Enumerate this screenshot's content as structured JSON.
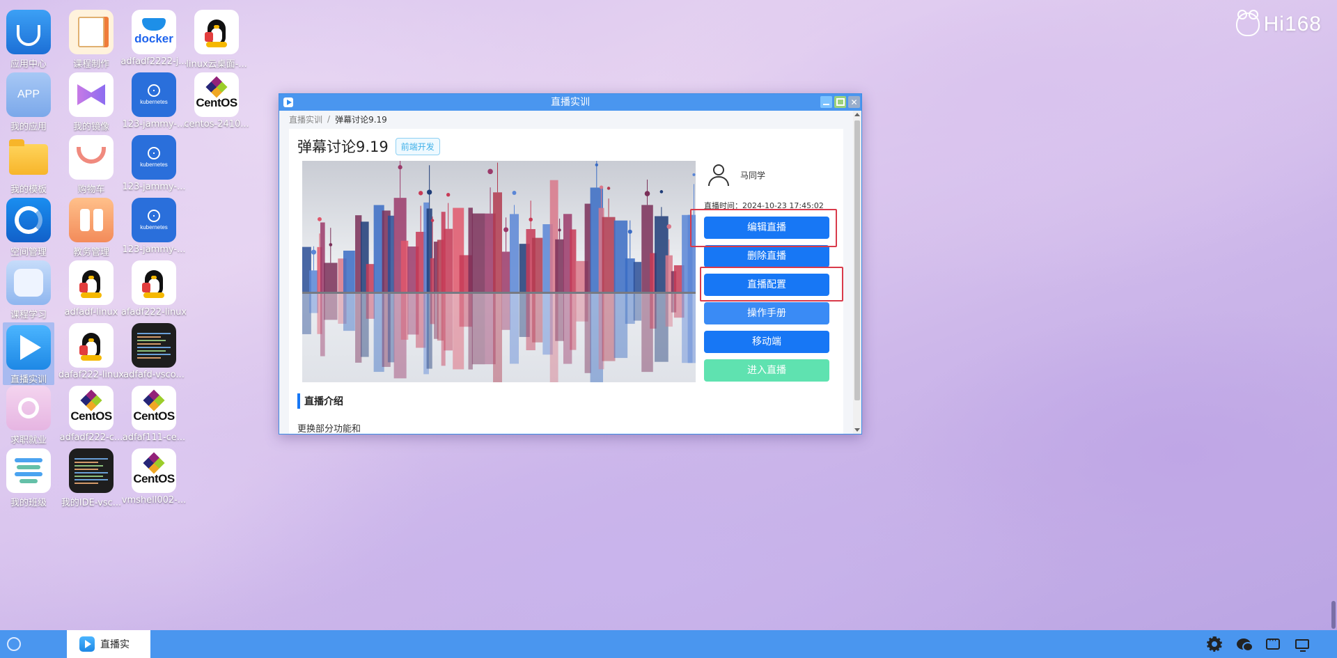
{
  "brand": {
    "logo_text": "Hi168"
  },
  "desktop": {
    "icons": [
      {
        "label": "应用中心",
        "icon": "app-center-icon"
      },
      {
        "label": "课程制作",
        "icon": "course-make-icon"
      },
      {
        "label": "adfadf2222-j...",
        "icon": "docker-icon",
        "logo_text": "docker"
      },
      {
        "label": "linux云桌面-...",
        "icon": "linux-tux-icon"
      },
      {
        "label": "我的应用",
        "icon": "my-app-icon",
        "logo_text": "APP"
      },
      {
        "label": "我的镜像",
        "icon": "my-image-icon"
      },
      {
        "label": "123-jammy-...",
        "icon": "kubernetes-icon",
        "logo_text": "kubernetes"
      },
      {
        "label": "centos-2410...",
        "icon": "centos-icon",
        "logo_text": "CentOS"
      },
      {
        "label": "我的模板",
        "icon": "folder-icon"
      },
      {
        "label": "购物车",
        "icon": "cart-icon"
      },
      {
        "label": "123-jammy-...",
        "icon": "kubernetes-icon",
        "logo_text": "kubernetes"
      },
      {
        "label": "空间管理",
        "icon": "space-manage-icon"
      },
      {
        "label": "教务管理",
        "icon": "edu-manage-icon"
      },
      {
        "label": "123-jammy-...",
        "icon": "kubernetes-icon",
        "logo_text": "kubernetes"
      },
      {
        "label": "课程学习",
        "icon": "course-study-icon"
      },
      {
        "label": "adfadf-linux",
        "icon": "linux-tux-icon"
      },
      {
        "label": "afadf222-linux",
        "icon": "linux-tux-icon"
      },
      {
        "label": "直播实训",
        "icon": "live-training-icon"
      },
      {
        "label": "dafaf222-linux",
        "icon": "linux-tux-icon"
      },
      {
        "label": "adfafd-vsco...",
        "icon": "vscode-icon"
      },
      {
        "label": "求职就业",
        "icon": "job-icon"
      },
      {
        "label": "adfadf222-c...",
        "icon": "centos-icon",
        "logo_text": "CentOS"
      },
      {
        "label": "adfaf111-ce...",
        "icon": "centos-icon",
        "logo_text": "CentOS"
      },
      {
        "label": "我的班级",
        "icon": "my-class-icon"
      },
      {
        "label": "我的IDE-vsc...",
        "icon": "vscode-icon"
      },
      {
        "label": "vmshell002-...",
        "icon": "centos-icon",
        "logo_text": "CentOS"
      }
    ]
  },
  "window": {
    "title": "直播实训",
    "breadcrumb": [
      "直播实训",
      "/",
      "弹幕讨论9.19"
    ],
    "page_title": "弹幕讨论9.19",
    "tag": "前端开发",
    "author": "马同学",
    "live_time": "直播时间：2024-10-23 17:45:02",
    "buttons": {
      "edit": "编辑直播",
      "delete": "删除直播",
      "config": "直播配置",
      "manual": "操作手册",
      "mobile": "移动端",
      "enter": "进入直播"
    },
    "section_title": "直播介绍",
    "description": "更换部分功能和",
    "close_glyph": "✕"
  },
  "taskbar": {
    "active_task": "直播实"
  },
  "colors": {
    "accent": "#1777f5",
    "titlebar": "#4a96ef",
    "enter_button": "#5fe2b0",
    "highlight": "#d93a4a"
  }
}
